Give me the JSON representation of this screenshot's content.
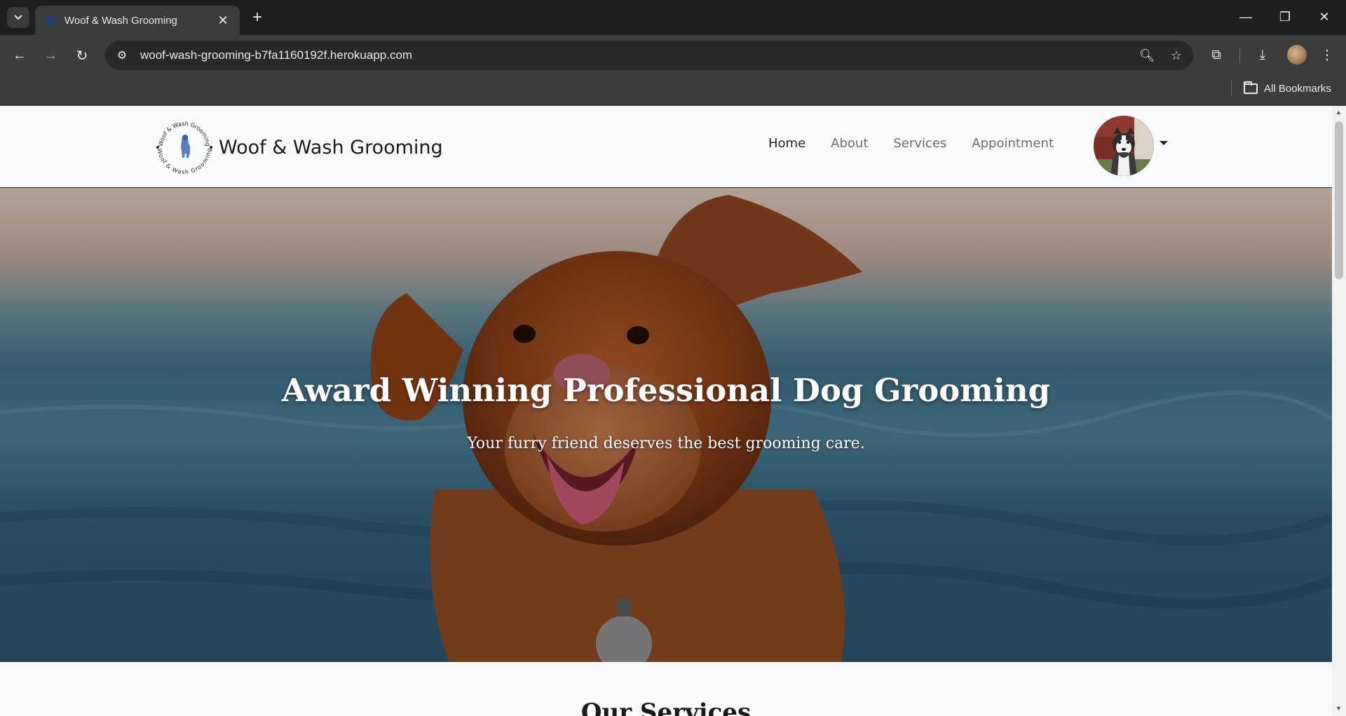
{
  "browser": {
    "tab_title": "Woof & Wash Grooming",
    "url": "woof-wash-grooming-b7fa1160192f.herokuapp.com",
    "bookmarks_label": "All Bookmarks"
  },
  "site": {
    "brand_name": "Woof & Wash Grooming",
    "logo_text_top": "Woof & Wash Grooming",
    "logo_text_bottom": "Woof & Wash Grooming",
    "nav": [
      {
        "label": "Home",
        "active": true
      },
      {
        "label": "About",
        "active": false
      },
      {
        "label": "Services",
        "active": false
      },
      {
        "label": "Appointment",
        "active": false
      }
    ]
  },
  "hero": {
    "title": "Award Winning Professional Dog Grooming",
    "subtitle": "Your furry friend deserves the best grooming care."
  },
  "services": {
    "heading": "Our Services"
  }
}
